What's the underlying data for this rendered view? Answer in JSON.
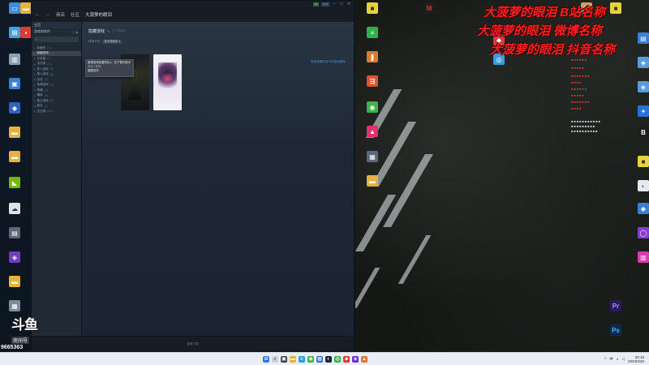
{
  "steam": {
    "nav": {
      "back": "←",
      "forward": "→",
      "items": [
        "商店",
        "社区",
        "大菠萝的眼泪"
      ]
    },
    "titlebar": {
      "badge": "▪ ▪ ▪",
      "min": "–",
      "max": "□",
      "close": "✕"
    },
    "sidebar": {
      "home_label": "主页",
      "filter_label": "游戏和软件",
      "search_placeholder": "",
      "categories": [
        {
          "label": "收藏夹",
          "count": "(2)"
        },
        {
          "label": "隐藏游戏",
          "count": "(1)"
        },
        {
          "label": "已安装",
          "count": "(0)"
        },
        {
          "label": "未分类",
          "count": "(0)"
        },
        {
          "label": "多人游戏",
          "count": "(8)"
        },
        {
          "label": "单人游戏",
          "count": "(6)"
        },
        {
          "label": "合作",
          "count": "(2)"
        },
        {
          "label": "免费游戏",
          "count": "(4)"
        },
        {
          "label": "策略",
          "count": "(3)"
        },
        {
          "label": "模拟",
          "count": "(5)"
        },
        {
          "label": "独立游戏",
          "count": "(9)"
        },
        {
          "label": "射击",
          "count": "(7)"
        },
        {
          "label": "无分类",
          "count": "(18)"
        }
      ]
    },
    "context_menu": {
      "items": [
        "管理游戏收藏项目 ▸  - 在下载列表中",
        "添加 / 移除",
        "隐藏游戏"
      ]
    },
    "collection": {
      "title": "隐藏游戏",
      "edit_icon": "✎",
      "subtitle": "(2 个项目)",
      "sort_label": "排序方式",
      "sort_value": "按字母顺序 ▾",
      "link": "将该收藏项目中的游戏移除"
    },
    "footer": "管理下载"
  },
  "overlay": {
    "lines": [
      "大菠萝的眼泪 B站名称",
      "大菠萝的眼泪 微博名称",
      "大菠萝的眼泪 抖音名称"
    ]
  },
  "watermark": {
    "logo": "斗鱼",
    "sub": "房间号",
    "room_id": "9665363"
  },
  "taskbar": {
    "time": "20:19",
    "date": "2023/3/22",
    "lang": "中"
  },
  "colors": {
    "overlay_red": "#ff1e1e",
    "steam_bg": "#1b2838"
  }
}
